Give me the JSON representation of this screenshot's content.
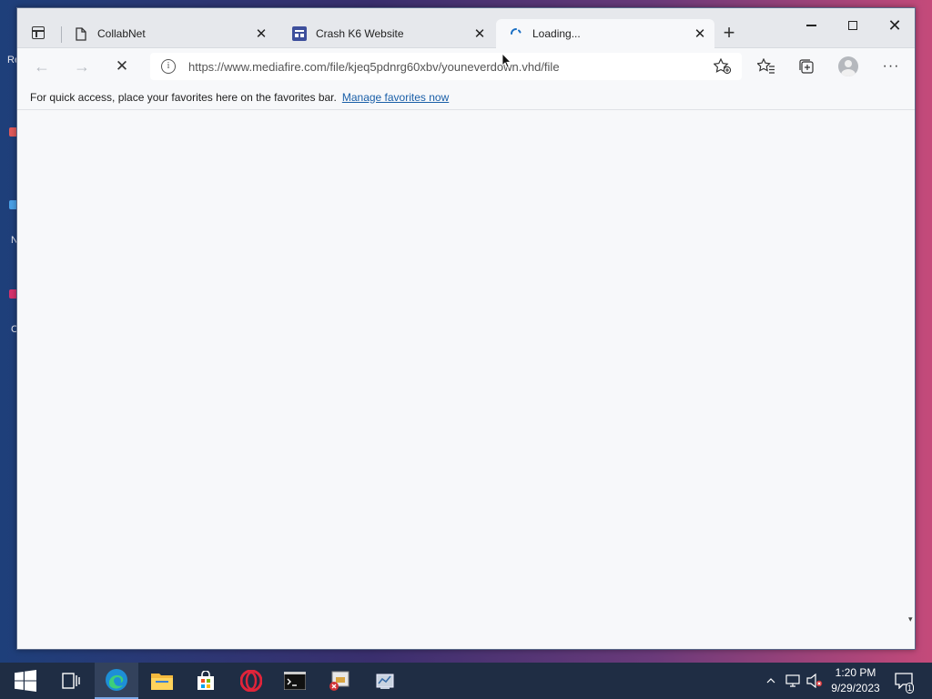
{
  "desktop": {
    "hints": [
      "Re",
      "N",
      "C"
    ]
  },
  "browser": {
    "tabs": [
      {
        "title": "CollabNet",
        "favicon": "page-icon",
        "active": false
      },
      {
        "title": "Crash K6 Website",
        "favicon": "site-icon",
        "active": false
      },
      {
        "title": "Loading...",
        "favicon": "loading-spinner-icon",
        "active": true
      }
    ],
    "new_tab_label": "+",
    "close_glyph": "✕",
    "window_controls": {
      "minimize": "minimize-icon",
      "maximize": "maximize-icon",
      "close": "✕"
    },
    "toolbar": {
      "back": "←",
      "forward": "→",
      "stop": "✕",
      "url": "https://www.mediafire.com/file/kjeq5pdnrg60xbv/youneverdown.vhd/file",
      "more": "···"
    },
    "favorites_bar": {
      "message": "For quick access, place your favorites here on the favorites bar.",
      "link": "Manage favorites now"
    }
  },
  "taskbar": {
    "apps": [
      "windows-start-icon",
      "task-view-icon",
      "edge-icon",
      "file-explorer-icon",
      "store-icon",
      "opera-icon",
      "terminal-icon",
      "installer-icon",
      "network-tool-icon"
    ],
    "clock": {
      "time": "1:20 PM",
      "date": "9/29/2023"
    },
    "notifications_count": "1"
  },
  "colors": {
    "accent": "#1a5fa8",
    "taskbar": "#1f2d44",
    "tabstrip": "#e6e8ec"
  }
}
